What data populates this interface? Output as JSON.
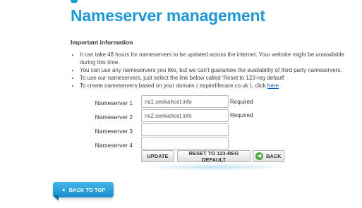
{
  "title": "Nameserver management",
  "info": {
    "heading": "Important information",
    "items": [
      "It can take 48 hours for nameservers to be updated across the internet. Your website might be unavailable during this time.",
      "You can use any nameservers you like, but we can't guarantee the availability of third party nameservers.",
      "To use our nameservers, just select the link below called 'Reset to 123-reg default'"
    ],
    "create_prefix": "To create nameservers based on your domain ( aspirelifecare.co.uk ), click ",
    "create_link": "here"
  },
  "form": {
    "rows": [
      {
        "label": "Nameserver 1",
        "value": "ns1.seekahost.info",
        "required": "Required"
      },
      {
        "label": "Nameserver 2",
        "value": "ns2.seekahost.info",
        "required": "Required"
      },
      {
        "label": "Nameserver 3",
        "value": "",
        "required": ""
      },
      {
        "label": "Nameserver 4",
        "value": "",
        "required": ""
      }
    ]
  },
  "buttons": {
    "update": "UPDATE",
    "reset": "RESET TO 123-REG DEFAULT",
    "back": "BACK",
    "back_icon": "back-arrow-icon"
  },
  "back_to_top": {
    "label": "BACK TO TOP",
    "icon": "up-arrow-icon"
  },
  "colors": {
    "title": "#1e98d4",
    "link": "#1a4fd8",
    "back_to_top_bg": "#1e9ad6",
    "back_icon": "#4aa83a"
  }
}
